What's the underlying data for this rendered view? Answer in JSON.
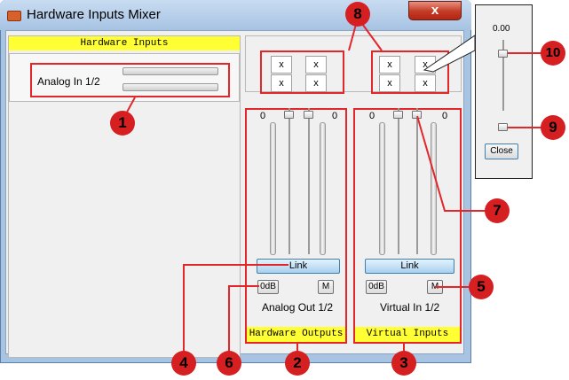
{
  "window": {
    "title": "Hardware Inputs Mixer",
    "close_glyph": "x"
  },
  "inputs_panel": {
    "header": "Hardware Inputs",
    "channel_label": "Analog In 1/2"
  },
  "matrix": {
    "cells_left": [
      "x",
      "x",
      "x",
      "x"
    ],
    "cells_right": [
      "x",
      "x",
      "x",
      "x"
    ]
  },
  "hw_outputs": {
    "left_value": "0",
    "right_value": "0",
    "link_label": "Link",
    "zero_db_label": "0dB",
    "mute_label": "M",
    "channel_label": "Analog Out 1/2",
    "footer": "Hardware Outputs"
  },
  "virtual_inputs": {
    "left_value": "0",
    "right_value": "0",
    "link_label": "Link",
    "zero_db_label": "0dB",
    "mute_label": "M",
    "channel_label": "Virtual In 1/2",
    "footer": "Virtual Inputs"
  },
  "popup": {
    "value": "0.00",
    "close_label": "Close"
  },
  "callouts": [
    "1",
    "2",
    "3",
    "4",
    "5",
    "6",
    "7",
    "8",
    "9",
    "10"
  ],
  "colors": {
    "accent": "#e3262a",
    "header_yellow": "#ffff33",
    "title_bar": "#b7cfea"
  }
}
